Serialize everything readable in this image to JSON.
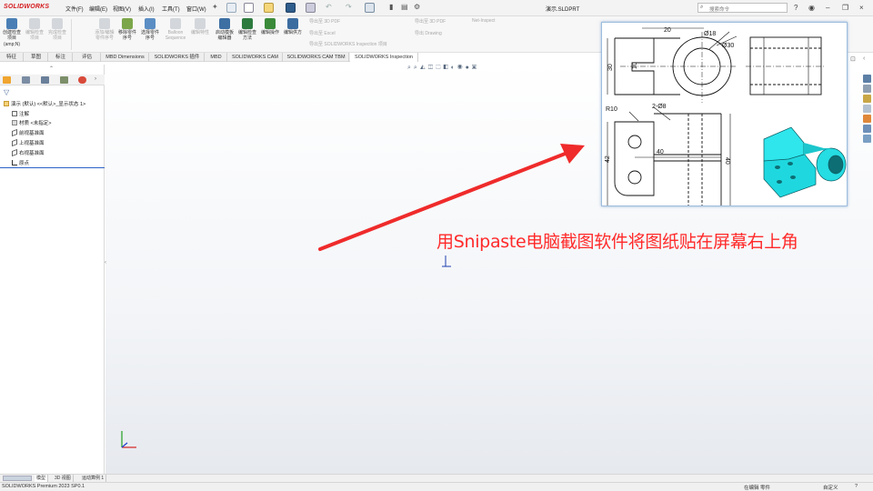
{
  "app": {
    "logo": "SOLIDWORKS",
    "document_title": "演示.SLDPRT",
    "search_placeholder": "搜索命令"
  },
  "menu": [
    "文件(F)",
    "编辑(E)",
    "视图(V)",
    "插入(I)",
    "工具(T)",
    "窗口(W)"
  ],
  "ribbon": {
    "buttons": [
      {
        "label": "创建检查项目",
        "sub": "(amp;N)",
        "enabled": true
      },
      {
        "label": "编辑检查项目",
        "enabled": false
      },
      {
        "label": "完成检查项目",
        "enabled": false
      },
      {
        "label": "添加/编辑零件序号",
        "enabled": false
      },
      {
        "label": "移除零件序号",
        "enabled": true
      },
      {
        "label": "选择零件序号",
        "enabled": true
      },
      {
        "label": "Balloon Sequence",
        "enabled": false
      },
      {
        "label": "编辑特性",
        "enabled": false
      },
      {
        "label": "启动模板编辑器",
        "enabled": true
      },
      {
        "label": "编辑检查方法",
        "enabled": true
      },
      {
        "label": "编辑操作",
        "enabled": true
      },
      {
        "label": "编辑供方",
        "enabled": true
      }
    ],
    "export_items": [
      "导出至 3D PDF",
      "导出至 Excel",
      "导出至 SOLIDWORKS Inspection 项目",
      "导出至 3D PDF",
      "导出 Drawing",
      "Net-Inspect"
    ]
  },
  "tabs": [
    {
      "label": "特征",
      "active": false
    },
    {
      "label": "草图",
      "active": false
    },
    {
      "label": "标注",
      "active": false
    },
    {
      "label": "评估",
      "active": false
    },
    {
      "label": "MBD Dimensions",
      "active": false
    },
    {
      "label": "SOLIDWORKS 插件",
      "active": false
    },
    {
      "label": "MBD",
      "active": false
    },
    {
      "label": "SOLIDWORKS CAM",
      "active": false
    },
    {
      "label": "SOLIDWORKS CAM TBM",
      "active": false
    },
    {
      "label": "SOLIDWORKS Inspection",
      "active": true
    }
  ],
  "tree": {
    "root": "演示 (默认) <<默认>_显示状态 1>",
    "items": [
      "注解",
      "材质 <未指定>",
      "前视基准面",
      "上视基准面",
      "右视基准面",
      "原点"
    ]
  },
  "annotation": "用Snipaste电脑截图软件将图纸贴在屏幕右上角",
  "drawing": {
    "dims": {
      "top_width": "20",
      "dia_small": "Ø18",
      "dia_large": "Ø30",
      "left_height": "30",
      "slot": "10",
      "radius": "R10",
      "holes": "2-Ø8",
      "length": "40",
      "height_left": "42",
      "height_right": "40"
    }
  },
  "bottom_tabs": [
    "模型",
    "3D 视图",
    "运动算例 1"
  ],
  "status": {
    "left": "SOLIDWORKS Premium 2023 SP0.1",
    "right": "在编辑 零件",
    "units": "自定义"
  },
  "colors": {
    "accent_red": "#d4191c",
    "annotation_red": "#ff2a2a",
    "model_cyan": "#22e0e6"
  }
}
